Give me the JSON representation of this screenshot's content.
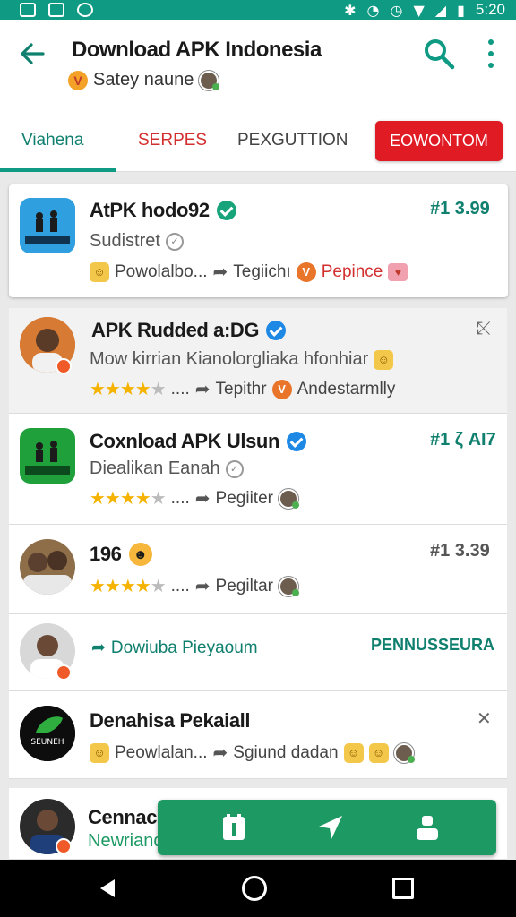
{
  "status_bar": {
    "time": "5:20"
  },
  "app_bar": {
    "title": "Download APK Indonesia",
    "subtitle_badge": "V",
    "subtitle": "Satey naune"
  },
  "tabs": [
    {
      "label": "Viahena",
      "active": true
    },
    {
      "label": "SERPES"
    },
    {
      "label": "PEXGUTTION"
    }
  ],
  "tab_button": "EOWONTOM",
  "items": [
    {
      "title": "AtPK hodo92",
      "subtitle": "Sudistret",
      "price": "#1 3.99",
      "meta": [
        "Powolalbo...",
        "Tegiichı",
        "Pepince"
      ]
    },
    {
      "title": "APK Rudded a:DG",
      "subtitle": "Mow kirrian Kianolorgliaka hfonhiar",
      "meta_ellipsis": "....",
      "meta": [
        "Tepithr",
        "Andestarmlly"
      ]
    },
    {
      "title": "Coxnload APK Ulsun",
      "subtitle": "Diealikan Eanah",
      "price": "#1 ζ AI7",
      "meta_ellipsis": "....",
      "meta": [
        "Pegiiter"
      ]
    },
    {
      "title": "196",
      "price": "#1 3.39",
      "meta_ellipsis": "....",
      "meta": [
        "Pegiltar"
      ]
    },
    {
      "link": "Dowiuba Pieyaoum",
      "action": "PENNUSSEURA"
    },
    {
      "title": "Denahisa Pekaiall",
      "icon_text": "SEUNEH",
      "meta": [
        "Peowlalan...",
        "Sgiund dadan"
      ]
    },
    {
      "title": "Cennac",
      "subtitle": "Newriand"
    }
  ],
  "colors": {
    "accent": "#0f9a83",
    "red_button": "#e01b24",
    "fab_bar": "#1d9a63",
    "price": "#0f7f6e"
  },
  "icons": [
    "back-arrow-icon",
    "search-icon",
    "more-vert-icon",
    "verified-icon",
    "share-icon",
    "star-icon",
    "close-icon",
    "calendar-icon",
    "navigation-icon",
    "person-icon"
  ]
}
